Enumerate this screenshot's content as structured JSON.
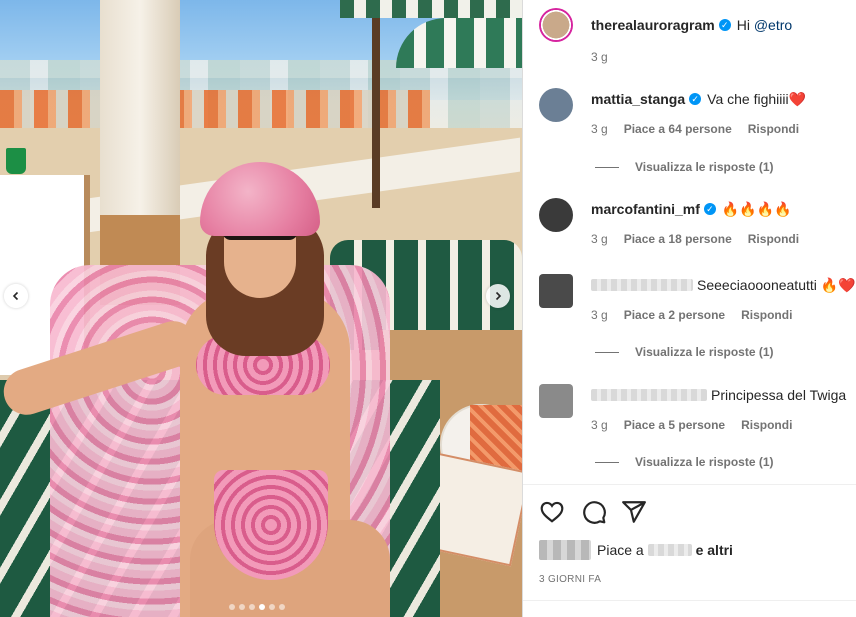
{
  "post": {
    "carousel": {
      "prev_icon": "chevron-left-icon",
      "next_icon": "chevron-right-icon",
      "slide_count": 6,
      "active_index": 3
    }
  },
  "comments": [
    {
      "username": "therealauroragram",
      "verified": true,
      "text_prefix": "Hi ",
      "mention": "@etro",
      "time": "3 g",
      "avatar_color": "#c9a98a"
    },
    {
      "username": "mattia_stanga",
      "verified": true,
      "text": "Va che fighiiii",
      "emoji": "❤️",
      "time": "3 g",
      "likes": "Piace a 64 persone",
      "reply": "Rispondi",
      "view_replies": "Visualizza le risposte (1)",
      "avatar_color": "#6b7f95"
    },
    {
      "username": "marcofantini_mf",
      "verified": true,
      "text": "🔥🔥🔥🔥",
      "time": "3 g",
      "likes": "Piace a 18 persone",
      "reply": "Rispondi",
      "avatar_color": "#3a3a3a"
    },
    {
      "username": "",
      "verified": false,
      "text": "Seeeciaoooneatutti",
      "emoji": "🔥❤️",
      "time": "3 g",
      "likes": "Piace a 2 persone",
      "reply": "Rispondi",
      "view_replies": "Visualizza le risposte (1)",
      "avatar_color": "#4a4a4a"
    },
    {
      "username": "",
      "verified": false,
      "text": "Principessa del Twiga",
      "time": "3 g",
      "likes": "Piace a 5 persone",
      "reply": "Rispondi",
      "view_replies": "Visualizza le risposte (1)",
      "avatar_color": "#8a8a8a"
    }
  ],
  "actions": {
    "like_icon": "heart-icon",
    "comment_icon": "comment-icon",
    "share_icon": "share-icon"
  },
  "likes_summary": {
    "prefix": "Piace a",
    "suffix": "e altri"
  },
  "time_ago": "3 GIORNI FA",
  "colors": {
    "verified": "#0095f6",
    "text": "#262626",
    "muted": "#737373"
  }
}
